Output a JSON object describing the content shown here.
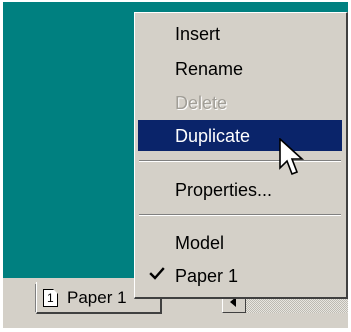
{
  "tabs": {
    "active_tab": {
      "icon": "page-icon",
      "icon_digit": "1",
      "label": "Paper 1"
    }
  },
  "scrollbar": {
    "left_arrow_icon": "left-arrow-icon"
  },
  "context_menu": {
    "insert_label": "Insert",
    "rename_label": "Rename",
    "delete_label": "Delete",
    "delete_disabled": true,
    "duplicate_label": "Duplicate",
    "duplicate_highlighted": true,
    "properties_label": "Properties...",
    "model_label": "Model",
    "paper1_label": "Paper 1",
    "paper1_checked": true,
    "check_icon": "checkmark-icon"
  },
  "cursor": {
    "icon": "arrow-cursor-icon"
  },
  "colors": {
    "desktop_teal": "#008080",
    "menu_face": "#d4d0c8",
    "highlight_navy": "#0a246a",
    "disabled_text": "#a19e97"
  }
}
